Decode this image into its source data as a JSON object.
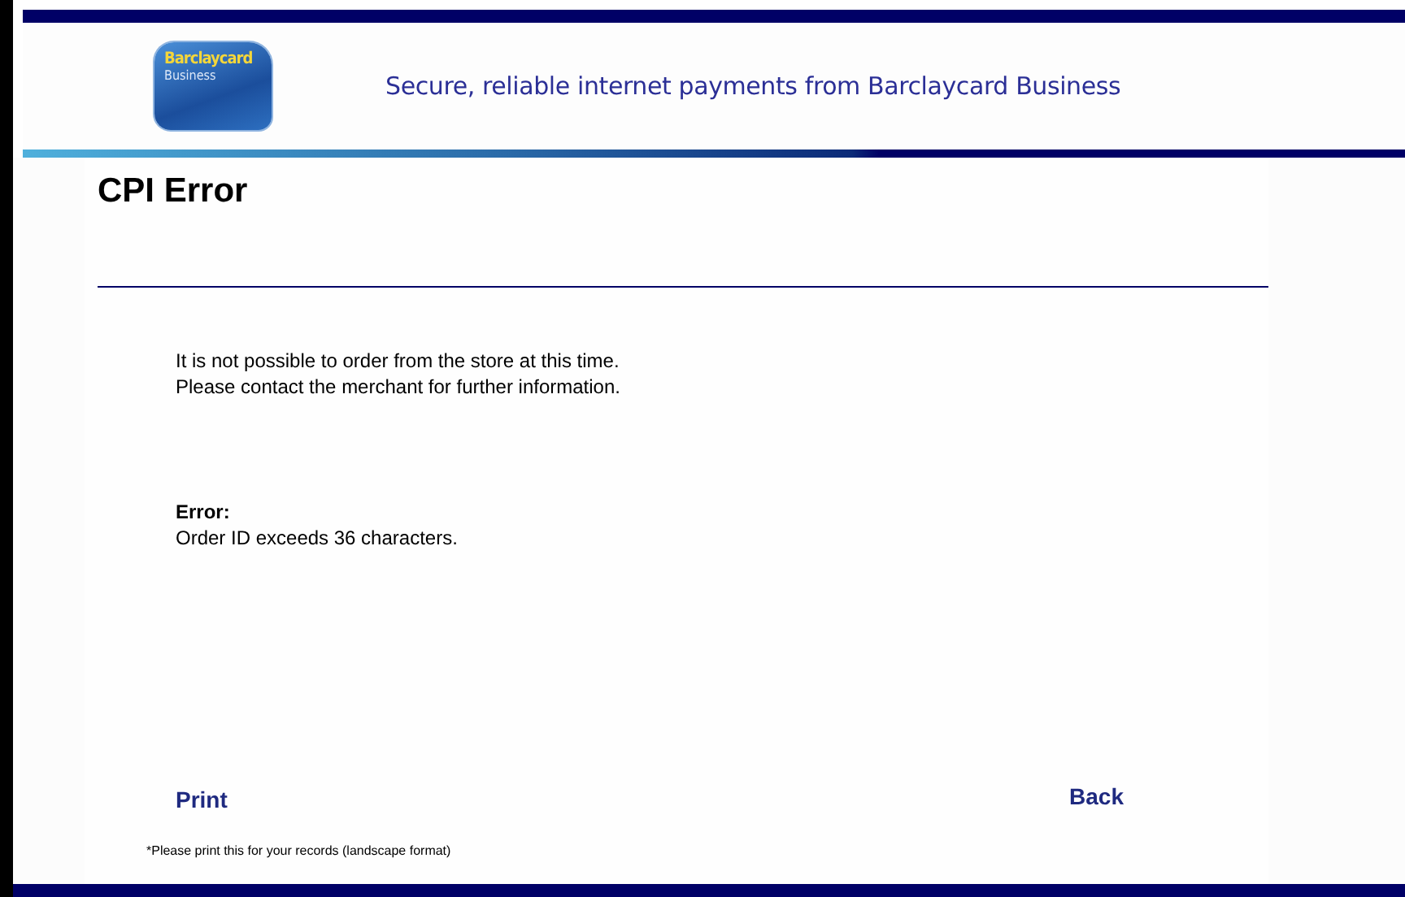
{
  "header": {
    "logo_lines": [
      "Barclaycard",
      "Business"
    ],
    "tagline": "Secure, reliable internet payments from Barclaycard Business"
  },
  "title": "CPI Error",
  "message": [
    "It is not possible to order from the store at this time.",
    "Please contact the merchant for further information."
  ],
  "error": {
    "label": "Error:",
    "text": "Order ID exceeds 36 characters."
  },
  "links": {
    "print": "Print",
    "back": "Back"
  },
  "footnote": "*Please print this for your records (landscape format)"
}
